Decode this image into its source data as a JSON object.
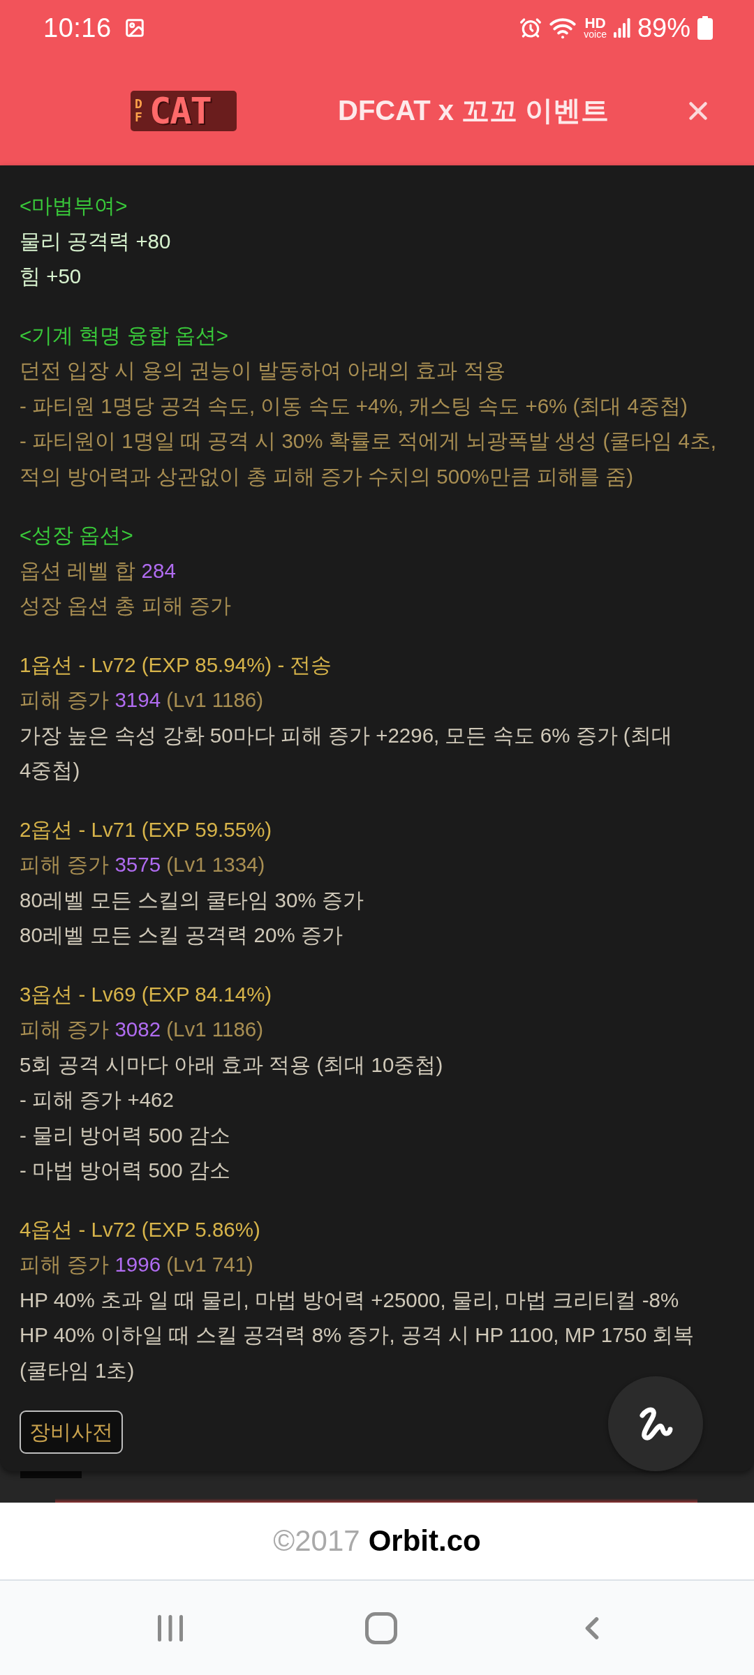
{
  "status_bar": {
    "time": "10:16",
    "network_type": [
      "HD",
      "voice"
    ],
    "battery": "89%"
  },
  "header": {
    "logo": {
      "prefix": "DF",
      "name": "CAT"
    },
    "title": "DFCAT x 꼬꼬 이벤트"
  },
  "sections": [
    {
      "heading": "<마법부여>",
      "items": [
        {
          "kind": "stat",
          "text": "물리 공격력 +80"
        },
        {
          "kind": "stat",
          "text": "힘 +50"
        }
      ]
    },
    {
      "heading": "<기계 혁명 융합 옵션>",
      "items": [
        {
          "kind": "note",
          "text": "던전 입장 시 용의 권능이 발동하여 아래의 효과 적용"
        },
        {
          "kind": "note",
          "text": "- 파티원 1명당 공격 속도, 이동 속도 +4%, 캐스팅 속도 +6% (최대 4중첩)"
        },
        {
          "kind": "note",
          "text": "- 파티원이 1명일 때 공격 시 30% 확률로 적에게 뇌광폭발 생성 (쿨타임 4초,\n적의 방어력과 상관없이 총 피해 증가 수치의 500%만큼 피해를 줌)"
        }
      ]
    },
    {
      "heading": "<성장 옵션>",
      "items": [
        {
          "kind": "total",
          "label": "옵션 레벨 합",
          "value": "284"
        },
        {
          "kind": "note",
          "text": "성장 옵션 총 피해 증가"
        }
      ]
    }
  ],
  "growth_options": [
    {
      "title": "1옵션 - Lv72 (EXP 85.94%) - 전송",
      "damage": {
        "label": "피해 증가",
        "value": "3194",
        "base": "(Lv1 1186)"
      },
      "effects": [
        "가장 높은 속성 강화 50마다 피해 증가 +2296, 모든 속도 6% 증가 (최대\n4중첩)"
      ]
    },
    {
      "title": "2옵션 - Lv71 (EXP 59.55%)",
      "damage": {
        "label": "피해 증가",
        "value": "3575",
        "base": "(Lv1 1334)"
      },
      "effects": [
        "80레벨 모든 스킬의 쿨타임 30% 증가",
        "80레벨 모든 스킬 공격력 20% 증가"
      ]
    },
    {
      "title": "3옵션 - Lv69 (EXP 84.14%)",
      "damage": {
        "label": "피해 증가",
        "value": "3082",
        "base": "(Lv1 1186)"
      },
      "effects": [
        "5회 공격 시마다 아래 효과 적용 (최대 10중첩)",
        "- 피해 증가 +462",
        "- 물리 방어력 500 감소",
        "- 마법 방어력 500 감소"
      ]
    },
    {
      "title": "4옵션 - Lv72 (EXP 5.86%)",
      "damage": {
        "label": "피해 증가",
        "value": "1996",
        "base": "(Lv1 741)"
      },
      "effects": [
        "HP 40% 초과 일 때 물리, 마법 방어력 +25000, 물리, 마법 크리티컬 -8%",
        "HP 40% 이하일 때 스킬 공격력 8% 증가, 공격 시 HP 1100, MP 1750 회복\n(쿨타임 1초)"
      ]
    }
  ],
  "dictionary_button": {
    "label": "장비사전"
  },
  "footer": {
    "copyright": "©2017",
    "brand": "Orbit.co"
  }
}
